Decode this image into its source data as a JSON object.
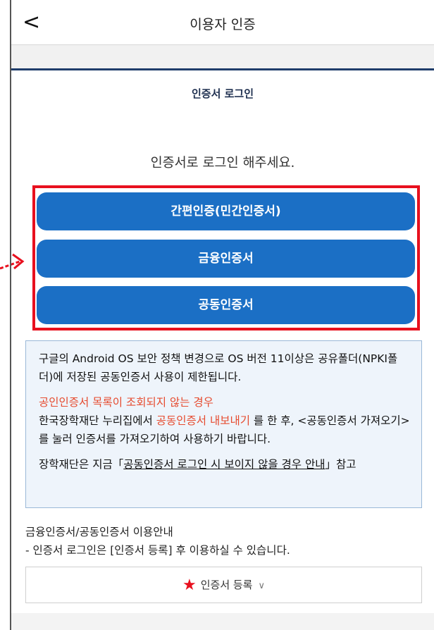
{
  "header": {
    "back_icon": "<",
    "title": "이용자 인증"
  },
  "section": {
    "title": "인증서 로그인",
    "prompt": "인증서로 로그인 해주세요."
  },
  "buttons": [
    {
      "label": "간편인증(민간인증서)"
    },
    {
      "label": "금융인증서"
    },
    {
      "label": "공동인증서"
    }
  ],
  "info": {
    "para1": "구글의 Android OS 보안 정책 변경으로 OS 버전 11이상은 공유폴더(NPKI폴더)에 저장된 공동인증서 사용이 제한됩니다.",
    "warning": "공인인증서 목록이 조회되지 않는 경우",
    "para2_a": "한국장학재단 누리집에서 ",
    "para2_link": "공동인증서 내보내기",
    "para2_b": " 를 한 후, <공동인증서 가져오기> 를 눌러 인증서를 가져오기하여 사용하기 바랍니다.",
    "para3_a": "장학재단은 지금「",
    "para3_link": "공동인증서 로그인 시 보이지 않을 경우 안내",
    "para3_b": "」참고"
  },
  "usage": {
    "title": "금융인증서/공동인증서 이용안내",
    "line": "- 인증서 로그인은 [인증서 등록] 후 이용하실 수 있습니다."
  },
  "register": {
    "star_icon": "★",
    "label": "인증서 등록",
    "chevron_icon": "∨"
  },
  "colors": {
    "accent": "#1b6fc5",
    "highlight": "#e8101e",
    "navy": "#1f3d6b",
    "warning": "#e64a2e"
  }
}
